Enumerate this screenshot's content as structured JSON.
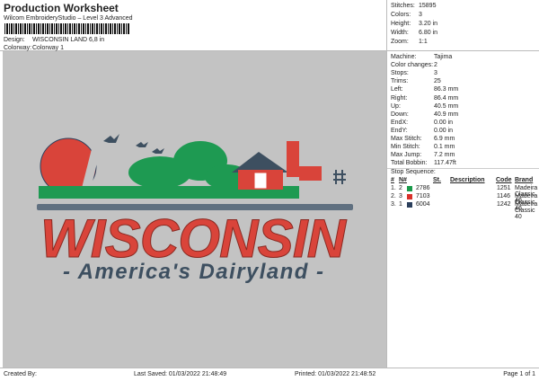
{
  "header": {
    "title": "Production Worksheet",
    "software": "Wilcom EmbroideryStudio – Level 3 Advanced",
    "design_label": "Design:",
    "design": "WISCONSIN LAND 6,8 in",
    "colorway_label": "Colorway:",
    "colorway": "Colorway 1"
  },
  "stats": [
    {
      "label": "Stitches:",
      "value": "15895"
    },
    {
      "label": "Colors:",
      "value": "3"
    },
    {
      "label": "Height:",
      "value": "3.20 in"
    },
    {
      "label": "Width:",
      "value": "6.80 in"
    },
    {
      "label": "Zoom:",
      "value": "1:1"
    }
  ],
  "details": [
    {
      "label": "Machine:",
      "value": "Tajima"
    },
    {
      "label": "Color changes:",
      "value": "2"
    },
    {
      "label": "Stops:",
      "value": "3"
    },
    {
      "label": "Trims:",
      "value": "25"
    },
    {
      "label": "Left:",
      "value": "86.3 mm"
    },
    {
      "label": "Right:",
      "value": "86.4 mm"
    },
    {
      "label": "Up:",
      "value": "40.5 mm"
    },
    {
      "label": "Down:",
      "value": "40.9 mm"
    },
    {
      "label": "EndX:",
      "value": "0.00 in"
    },
    {
      "label": "EndY:",
      "value": "0.00 in"
    },
    {
      "label": "Max Stitch:",
      "value": "6.9 mm"
    },
    {
      "label": "Min Stitch:",
      "value": "0.1 mm"
    },
    {
      "label": "Max Jump:",
      "value": "7.2 mm"
    },
    {
      "label": "Total Bobbin:",
      "value": "117.47ft"
    }
  ],
  "stop_sequence": {
    "title": "Stop Sequence:",
    "columns": [
      "#",
      "N#",
      "St.",
      "Description",
      "Code",
      "Brand"
    ],
    "rows": [
      {
        "num": "1.",
        "n": "2",
        "color": "#1a9a4a",
        "st": "2786",
        "code": "1251",
        "brand": "Madeira Classic 40"
      },
      {
        "num": "2.",
        "n": "3",
        "color": "#d9322b",
        "st": "7103",
        "code": "1146",
        "brand": "Madeira Classic 40"
      },
      {
        "num": "3.",
        "n": "1",
        "color": "#2b3f5c",
        "st": "6004",
        "code": "1242",
        "brand": "Madeira Classic 40"
      }
    ]
  },
  "logo": {
    "line1": "WISCONSIN",
    "line2": "- America's Dairyland -"
  },
  "footer": {
    "created": "Created By:",
    "saved": "Last Saved: 01/03/2022 21:48:49",
    "printed": "Printed: 01/03/2022 21:48:52",
    "page": "Page 1 of 1"
  }
}
